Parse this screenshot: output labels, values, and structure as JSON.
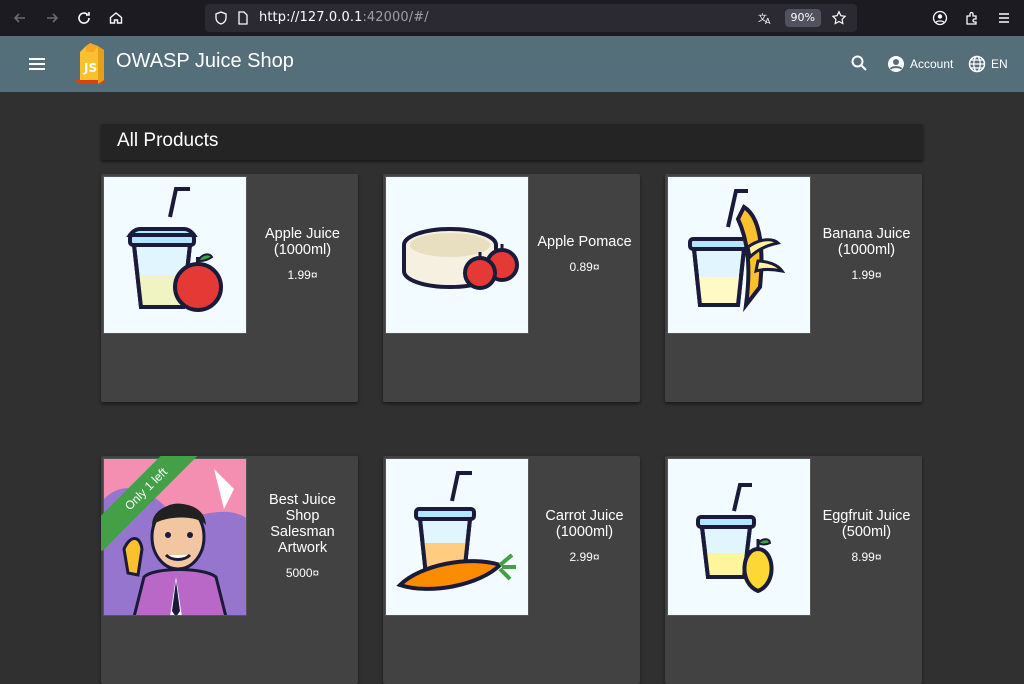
{
  "browser": {
    "url_host": "http://127.0.0.1",
    "url_rest": ":42000/#/",
    "zoom": "90%"
  },
  "toolbar": {
    "title": "OWASP Juice Shop",
    "account_label": "Account",
    "language_label": "EN"
  },
  "page": {
    "heading": "All Products"
  },
  "products": [
    {
      "name": "Apple Juice (1000ml)",
      "price": "1.99¤",
      "image": "apple-juice"
    },
    {
      "name": "Apple Pomace",
      "price": "0.89¤",
      "image": "apple-pomace"
    },
    {
      "name": "Banana Juice (1000ml)",
      "price": "1.99¤",
      "image": "banana-juice"
    },
    {
      "name": "Best Juice Shop Salesman Artwork",
      "price": "5000¤",
      "image": "salesman-artwork",
      "ribbon": "Only 1 left"
    },
    {
      "name": "Carrot Juice (1000ml)",
      "price": "2.99¤",
      "image": "carrot-juice"
    },
    {
      "name": "Eggfruit Juice (500ml)",
      "price": "8.99¤",
      "image": "eggfruit-juice"
    }
  ],
  "colors": {
    "toolbar": "#546e7a",
    "background": "#303030",
    "card": "#424242",
    "ribbon": "#43a047"
  }
}
